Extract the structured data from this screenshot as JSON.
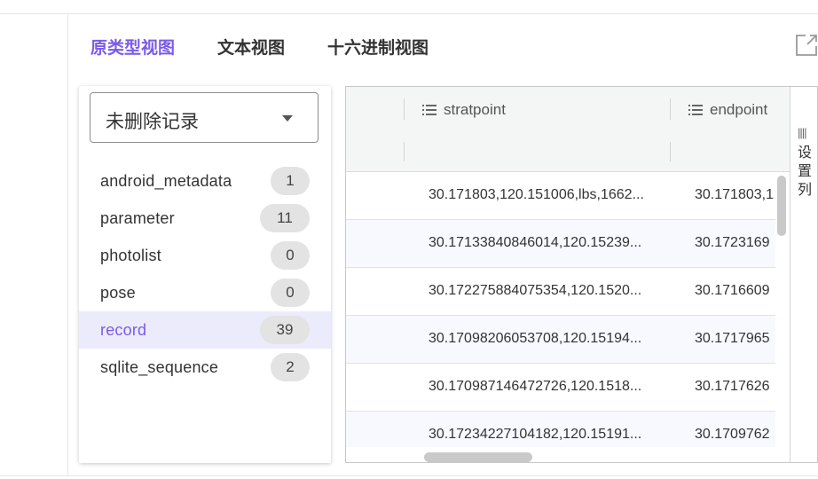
{
  "tabs": [
    {
      "label": "原类型视图",
      "active": true
    },
    {
      "label": "文本视图",
      "active": false
    },
    {
      "label": "十六进制视图",
      "active": false
    }
  ],
  "icons": {
    "external": "external-link-icon",
    "caret": "chevron-down-icon",
    "column_menu": "menu-icon",
    "columns": "columns-icon"
  },
  "colors": {
    "accent": "#7b5be8",
    "selected_bg": "#ecebfb"
  },
  "filter": {
    "selected": "未删除记录"
  },
  "tables": [
    {
      "name": "android_metadata",
      "count": "1"
    },
    {
      "name": "parameter",
      "count": "11"
    },
    {
      "name": "photolist",
      "count": "0"
    },
    {
      "name": "pose",
      "count": "0"
    },
    {
      "name": "record",
      "count": "39",
      "selected": true
    },
    {
      "name": "sqlite_sequence",
      "count": "2"
    }
  ],
  "grid": {
    "columns": [
      "stratpoint",
      "endpoint"
    ],
    "rows": [
      [
        "30.171803,120.151006,lbs,1662...",
        "30.171803,1"
      ],
      [
        "30.17133840846014,120.15239...",
        "30.1723169"
      ],
      [
        "30.172275884075354,120.1520...",
        "30.1716609"
      ],
      [
        "30.17098206053708,120.15194...",
        "30.1717965"
      ],
      [
        "30.170987146472726,120.1518...",
        "30.1717626"
      ],
      [
        "30.17234227104182,120.15191...",
        "30.1709762"
      ]
    ],
    "side_icon": "||||",
    "side_label": "设置列"
  }
}
